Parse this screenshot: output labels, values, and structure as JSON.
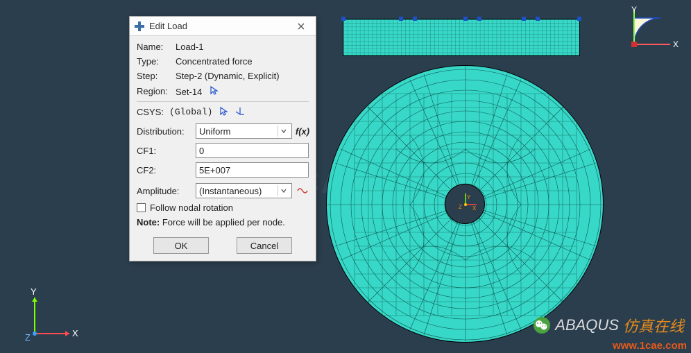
{
  "dialog": {
    "title": "Edit Load",
    "name_label": "Name:",
    "name_value": "Load-1",
    "type_label": "Type:",
    "type_value": "Concentrated force",
    "step_label": "Step:",
    "step_value": "Step-2 (Dynamic, Explicit)",
    "region_label": "Region:",
    "region_value": "Set-14",
    "csys_label": "CSYS:",
    "csys_value": "(Global)",
    "distribution_label": "Distribution:",
    "distribution_value": "Uniform",
    "fx_label": "f(x)",
    "cf1_label": "CF1:",
    "cf1_value": "0",
    "cf2_label": "CF2:",
    "cf2_value": "5E+007",
    "amplitude_label": "Amplitude:",
    "amplitude_value": "(Instantaneous)",
    "follow_label": "Follow nodal rotation",
    "note_bold": "Note:",
    "note_text": "Force will be applied per node.",
    "ok": "OK",
    "cancel": "Cancel"
  },
  "axes": {
    "x": "X",
    "y": "Y",
    "z": "Z"
  },
  "watermark": {
    "brand": "ABAQUS",
    "cn": "仿真在线",
    "url": "www.1cae.com",
    "faint": "1CAE.com"
  }
}
